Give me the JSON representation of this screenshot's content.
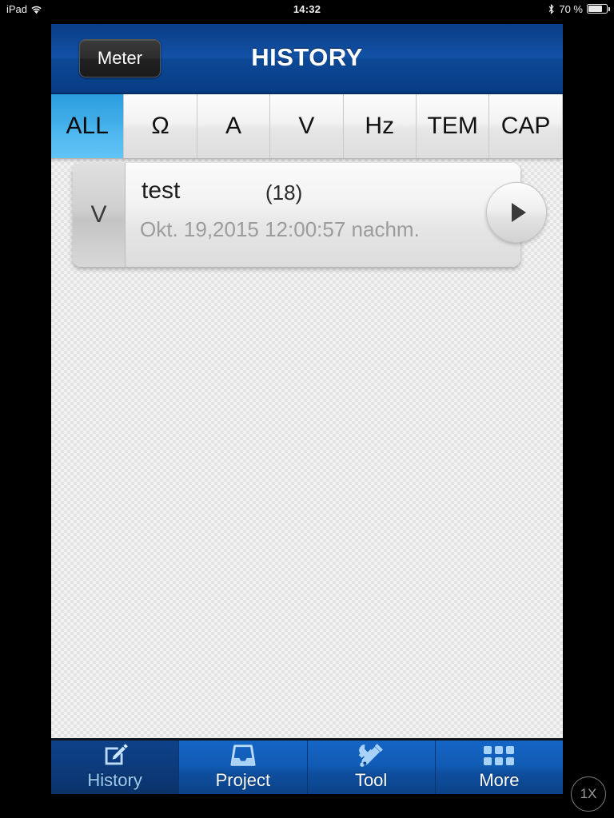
{
  "status_bar": {
    "device": "iPad",
    "wifi_icon": "wifi-icon",
    "time": "14:32",
    "bluetooth_icon": "bluetooth-icon",
    "battery_percent": "70 %",
    "battery_icon": "battery-icon"
  },
  "nav": {
    "back_label": "Meter",
    "title": "HISTORY"
  },
  "filters": {
    "tabs": [
      {
        "label": "ALL",
        "selected": true
      },
      {
        "label": "Ω",
        "selected": false
      },
      {
        "label": "A",
        "selected": false
      },
      {
        "label": "V",
        "selected": false
      },
      {
        "label": "Hz",
        "selected": false
      },
      {
        "label": "TEM",
        "selected": false
      },
      {
        "label": "CAP",
        "selected": false
      }
    ]
  },
  "history": {
    "items": [
      {
        "badge": "V",
        "title": "test",
        "count": "(18)",
        "date": "Okt. 19,2015 12:00:57 nachm.",
        "disclosure_icon": "play-arrow-icon"
      }
    ]
  },
  "tab_bar": {
    "items": [
      {
        "label": "History",
        "icon": "note-pencil-icon",
        "selected": true
      },
      {
        "label": "Project",
        "icon": "inbox-tray-icon",
        "selected": false
      },
      {
        "label": "Tool",
        "icon": "wrench-screwdriver-icon",
        "selected": false
      },
      {
        "label": "More",
        "icon": "grid-dots-icon",
        "selected": false
      }
    ]
  },
  "zoom_badge": {
    "label": "1X"
  },
  "colors": {
    "nav_blue": "#1251a5",
    "tab_selected_blue": "#4fb7ef",
    "tab_bar_blue": "#115cb4",
    "tab_bar_selected": "#0c3b7c",
    "icon_blue": "#a8d2f7",
    "content_bg": "#e3e3e3",
    "card_bg": "#f2f2f2",
    "date_text": "#9c9c9c"
  }
}
